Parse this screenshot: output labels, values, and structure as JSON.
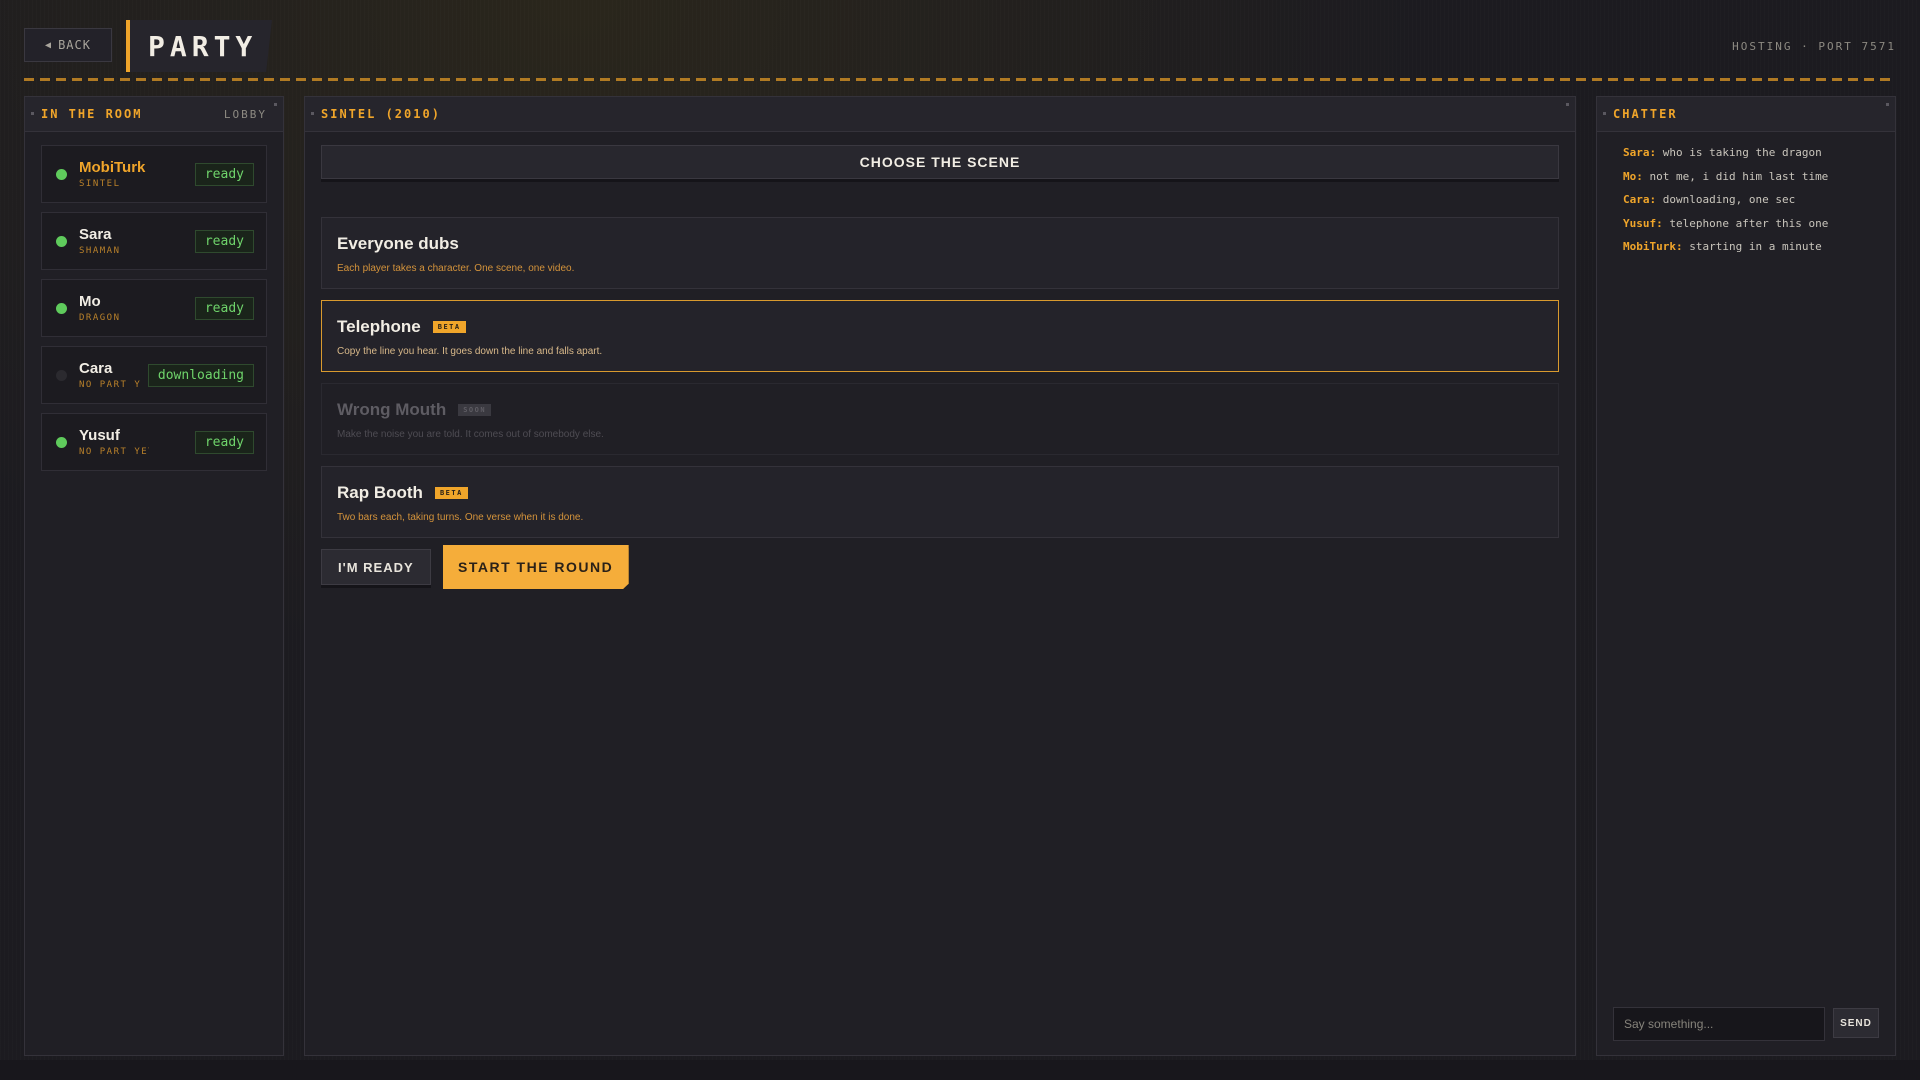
{
  "header": {
    "back_label": "BACK",
    "back_icon": "left-triangle",
    "title": "PARTY",
    "hosting": "HOSTING · PORT 7571"
  },
  "room": {
    "title": "IN THE ROOM",
    "sub": "LOBBY",
    "players": [
      {
        "name": "MobiTurk",
        "role": "SINTEL",
        "status": "ready",
        "online": true,
        "is_me": true
      },
      {
        "name": "Sara",
        "role": "SHAMAN",
        "status": "ready",
        "online": true,
        "is_me": false
      },
      {
        "name": "Mo",
        "role": "DRAGON",
        "status": "ready",
        "online": true,
        "is_me": false
      },
      {
        "name": "Cara",
        "role": "NO PART YET",
        "status": "downloading",
        "online": false,
        "is_me": false
      },
      {
        "name": "Yusuf",
        "role": "NO PART YET",
        "status": "ready",
        "online": true,
        "is_me": false
      }
    ]
  },
  "main": {
    "title": "SINTEL (2010)",
    "choose_label": "CHOOSE THE SCENE",
    "modes": [
      {
        "name": "Everyone dubs",
        "badge": "",
        "desc": "Each player takes a character. One scene, one video.",
        "state": "normal"
      },
      {
        "name": "Telephone",
        "badge": "BETA",
        "desc": "Copy the line you hear. It goes down the line and falls apart.",
        "state": "selected"
      },
      {
        "name": "Wrong Mouth",
        "badge": "SOON",
        "desc": "Make the noise you are told. It comes out of somebody else.",
        "state": "disabled"
      },
      {
        "name": "Rap Booth",
        "badge": "BETA",
        "desc": "Two bars each, taking turns. One verse when it is done.",
        "state": "normal"
      }
    ],
    "ready_label": "I'M READY",
    "start_label": "START THE ROUND"
  },
  "chat": {
    "title": "CHATTER",
    "messages": [
      {
        "who": "Sara:",
        "text": "who is taking the dragon"
      },
      {
        "who": "Mo:",
        "text": "not me, i did him last time"
      },
      {
        "who": "Cara:",
        "text": "downloading, one sec"
      },
      {
        "who": "Yusuf:",
        "text": "telephone after this one"
      },
      {
        "who": "MobiTurk:",
        "text": "starting in a minute"
      }
    ],
    "placeholder": "Say something...",
    "send_label": "SEND"
  },
  "colors": {
    "accent": "#f0a52a",
    "ready_green": "#6fd46b",
    "online_dot": "#5fcb5c"
  }
}
